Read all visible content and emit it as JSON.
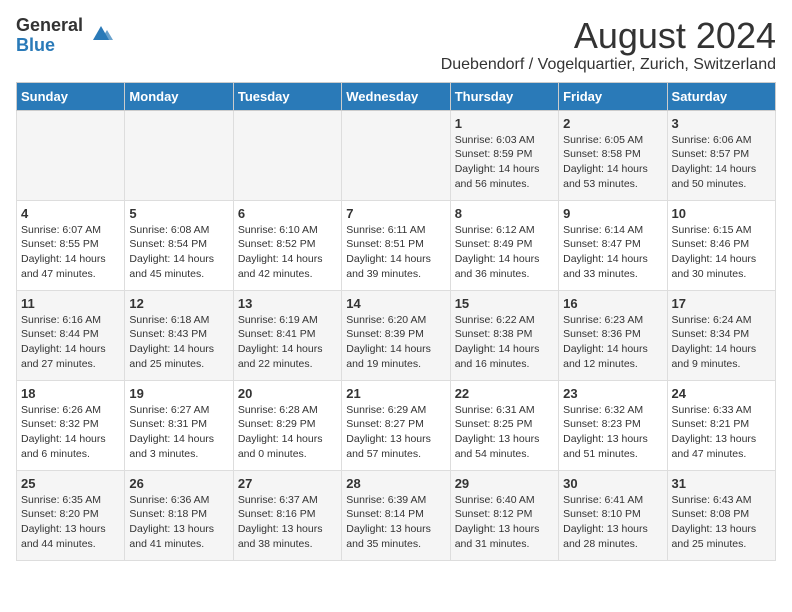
{
  "header": {
    "logo_general": "General",
    "logo_blue": "Blue",
    "title": "August 2024",
    "subtitle": "Duebendorf / Vogelquartier, Zurich, Switzerland"
  },
  "weekdays": [
    "Sunday",
    "Monday",
    "Tuesday",
    "Wednesday",
    "Thursday",
    "Friday",
    "Saturday"
  ],
  "weeks": [
    [
      {
        "day": "",
        "info": ""
      },
      {
        "day": "",
        "info": ""
      },
      {
        "day": "",
        "info": ""
      },
      {
        "day": "",
        "info": ""
      },
      {
        "day": "1",
        "info": "Sunrise: 6:03 AM\nSunset: 8:59 PM\nDaylight: 14 hours and 56 minutes."
      },
      {
        "day": "2",
        "info": "Sunrise: 6:05 AM\nSunset: 8:58 PM\nDaylight: 14 hours and 53 minutes."
      },
      {
        "day": "3",
        "info": "Sunrise: 6:06 AM\nSunset: 8:57 PM\nDaylight: 14 hours and 50 minutes."
      }
    ],
    [
      {
        "day": "4",
        "info": "Sunrise: 6:07 AM\nSunset: 8:55 PM\nDaylight: 14 hours and 47 minutes."
      },
      {
        "day": "5",
        "info": "Sunrise: 6:08 AM\nSunset: 8:54 PM\nDaylight: 14 hours and 45 minutes."
      },
      {
        "day": "6",
        "info": "Sunrise: 6:10 AM\nSunset: 8:52 PM\nDaylight: 14 hours and 42 minutes."
      },
      {
        "day": "7",
        "info": "Sunrise: 6:11 AM\nSunset: 8:51 PM\nDaylight: 14 hours and 39 minutes."
      },
      {
        "day": "8",
        "info": "Sunrise: 6:12 AM\nSunset: 8:49 PM\nDaylight: 14 hours and 36 minutes."
      },
      {
        "day": "9",
        "info": "Sunrise: 6:14 AM\nSunset: 8:47 PM\nDaylight: 14 hours and 33 minutes."
      },
      {
        "day": "10",
        "info": "Sunrise: 6:15 AM\nSunset: 8:46 PM\nDaylight: 14 hours and 30 minutes."
      }
    ],
    [
      {
        "day": "11",
        "info": "Sunrise: 6:16 AM\nSunset: 8:44 PM\nDaylight: 14 hours and 27 minutes."
      },
      {
        "day": "12",
        "info": "Sunrise: 6:18 AM\nSunset: 8:43 PM\nDaylight: 14 hours and 25 minutes."
      },
      {
        "day": "13",
        "info": "Sunrise: 6:19 AM\nSunset: 8:41 PM\nDaylight: 14 hours and 22 minutes."
      },
      {
        "day": "14",
        "info": "Sunrise: 6:20 AM\nSunset: 8:39 PM\nDaylight: 14 hours and 19 minutes."
      },
      {
        "day": "15",
        "info": "Sunrise: 6:22 AM\nSunset: 8:38 PM\nDaylight: 14 hours and 16 minutes."
      },
      {
        "day": "16",
        "info": "Sunrise: 6:23 AM\nSunset: 8:36 PM\nDaylight: 14 hours and 12 minutes."
      },
      {
        "day": "17",
        "info": "Sunrise: 6:24 AM\nSunset: 8:34 PM\nDaylight: 14 hours and 9 minutes."
      }
    ],
    [
      {
        "day": "18",
        "info": "Sunrise: 6:26 AM\nSunset: 8:32 PM\nDaylight: 14 hours and 6 minutes."
      },
      {
        "day": "19",
        "info": "Sunrise: 6:27 AM\nSunset: 8:31 PM\nDaylight: 14 hours and 3 minutes."
      },
      {
        "day": "20",
        "info": "Sunrise: 6:28 AM\nSunset: 8:29 PM\nDaylight: 14 hours and 0 minutes."
      },
      {
        "day": "21",
        "info": "Sunrise: 6:29 AM\nSunset: 8:27 PM\nDaylight: 13 hours and 57 minutes."
      },
      {
        "day": "22",
        "info": "Sunrise: 6:31 AM\nSunset: 8:25 PM\nDaylight: 13 hours and 54 minutes."
      },
      {
        "day": "23",
        "info": "Sunrise: 6:32 AM\nSunset: 8:23 PM\nDaylight: 13 hours and 51 minutes."
      },
      {
        "day": "24",
        "info": "Sunrise: 6:33 AM\nSunset: 8:21 PM\nDaylight: 13 hours and 47 minutes."
      }
    ],
    [
      {
        "day": "25",
        "info": "Sunrise: 6:35 AM\nSunset: 8:20 PM\nDaylight: 13 hours and 44 minutes."
      },
      {
        "day": "26",
        "info": "Sunrise: 6:36 AM\nSunset: 8:18 PM\nDaylight: 13 hours and 41 minutes."
      },
      {
        "day": "27",
        "info": "Sunrise: 6:37 AM\nSunset: 8:16 PM\nDaylight: 13 hours and 38 minutes."
      },
      {
        "day": "28",
        "info": "Sunrise: 6:39 AM\nSunset: 8:14 PM\nDaylight: 13 hours and 35 minutes."
      },
      {
        "day": "29",
        "info": "Sunrise: 6:40 AM\nSunset: 8:12 PM\nDaylight: 13 hours and 31 minutes."
      },
      {
        "day": "30",
        "info": "Sunrise: 6:41 AM\nSunset: 8:10 PM\nDaylight: 13 hours and 28 minutes."
      },
      {
        "day": "31",
        "info": "Sunrise: 6:43 AM\nSunset: 8:08 PM\nDaylight: 13 hours and 25 minutes."
      }
    ]
  ]
}
